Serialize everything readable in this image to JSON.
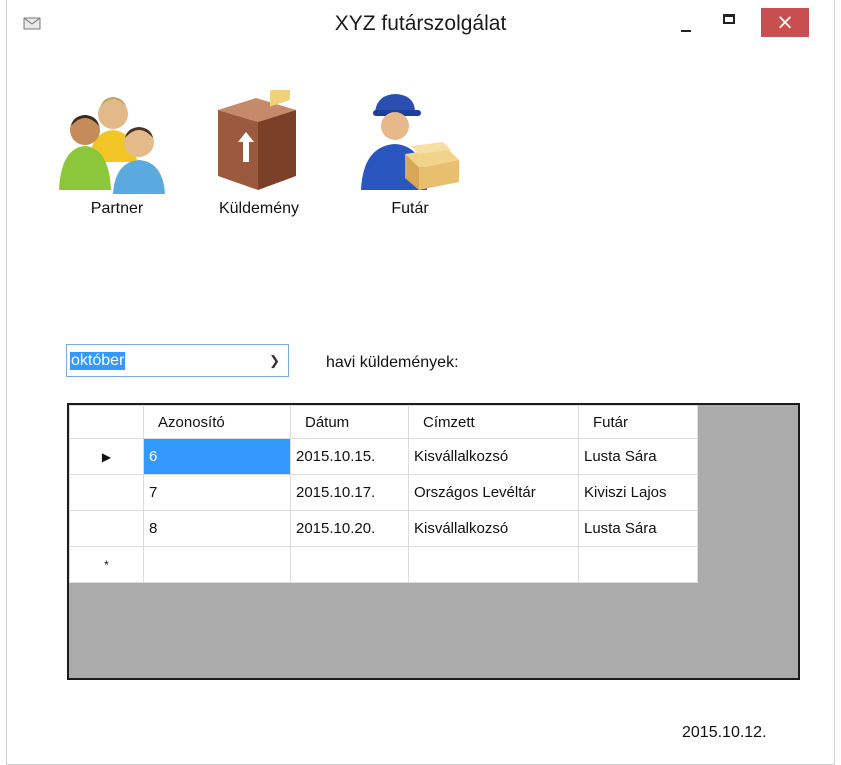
{
  "window": {
    "title": "XYZ futárszolgálat",
    "close_glyph": "×"
  },
  "toolbar": {
    "partner": {
      "label": "Partner",
      "icon": "people-group-icon"
    },
    "kuldemeny": {
      "label": "Küldemény",
      "icon": "package-box-icon"
    },
    "futar": {
      "label": "Futár",
      "icon": "courier-icon"
    }
  },
  "filter": {
    "month": "október",
    "caption": "havi küldemények:"
  },
  "grid": {
    "columns": [
      "Azonosító",
      "Dátum",
      "Címzett",
      "Futár"
    ],
    "rows": [
      {
        "marker": "▶",
        "id": "6",
        "date": "2015.10.15.",
        "recipient": "Kisvállalkozsó",
        "courier": "Lusta Sára"
      },
      {
        "marker": "",
        "id": "7",
        "date": "2015.10.17.",
        "recipient": "Országos Levéltár",
        "courier": "Kiviszi Lajos"
      },
      {
        "marker": "",
        "id": "8",
        "date": "2015.10.20.",
        "recipient": "Kisvállalkozsó",
        "courier": "Lusta Sára"
      }
    ],
    "new_row_marker": "*"
  },
  "status": {
    "date": "2015.10.12."
  },
  "colors": {
    "selection": "#3399ff",
    "close": "#c74f4f",
    "grid_bg": "#ababab"
  }
}
